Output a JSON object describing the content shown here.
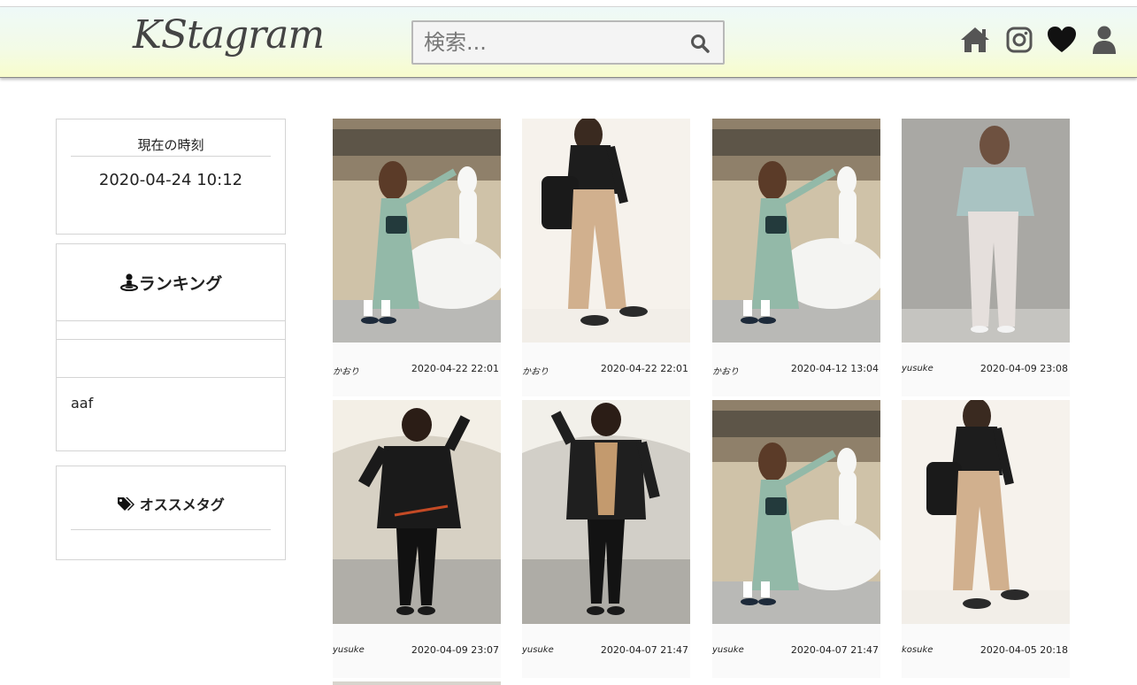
{
  "header": {
    "logo": "KStagram",
    "search_placeholder": "検索..."
  },
  "nav_icons": [
    "home-icon",
    "instagram-icon",
    "heart-icon",
    "user-icon"
  ],
  "sidebar": {
    "clock": {
      "title": "現在の時刻",
      "value": "2020-04-24 10:12"
    },
    "ranking": {
      "title": "ランキング",
      "rows": [
        "",
        "",
        "aaf"
      ]
    },
    "tags": {
      "title": "オススメタグ"
    }
  },
  "posts": [
    {
      "user": "かおり",
      "date": "2020-04-22 22:01",
      "photo": "green-dress-woman"
    },
    {
      "user": "かおり",
      "date": "2020-04-22 22:01",
      "photo": "beige-pants-woman"
    },
    {
      "user": "かおり",
      "date": "2020-04-12 13:04",
      "photo": "green-dress-woman"
    },
    {
      "user": "yusuke",
      "date": "2020-04-09 23:08",
      "photo": "knit-sweater-woman"
    },
    {
      "user": "yusuke",
      "date": "2020-04-09 23:07",
      "photo": "black-sweater-man"
    },
    {
      "user": "yusuke",
      "date": "2020-04-07 21:47",
      "photo": "black-jacket-man"
    },
    {
      "user": "yusuke",
      "date": "2020-04-07 21:47",
      "photo": "green-dress-woman"
    },
    {
      "user": "kosuke",
      "date": "2020-04-05 20:18",
      "photo": "beige-pants-woman"
    }
  ],
  "colors": {
    "header_top": "#eef9f8",
    "header_bottom": "#f8fccc",
    "icon": "#555555",
    "border": "#d4d4d4"
  }
}
